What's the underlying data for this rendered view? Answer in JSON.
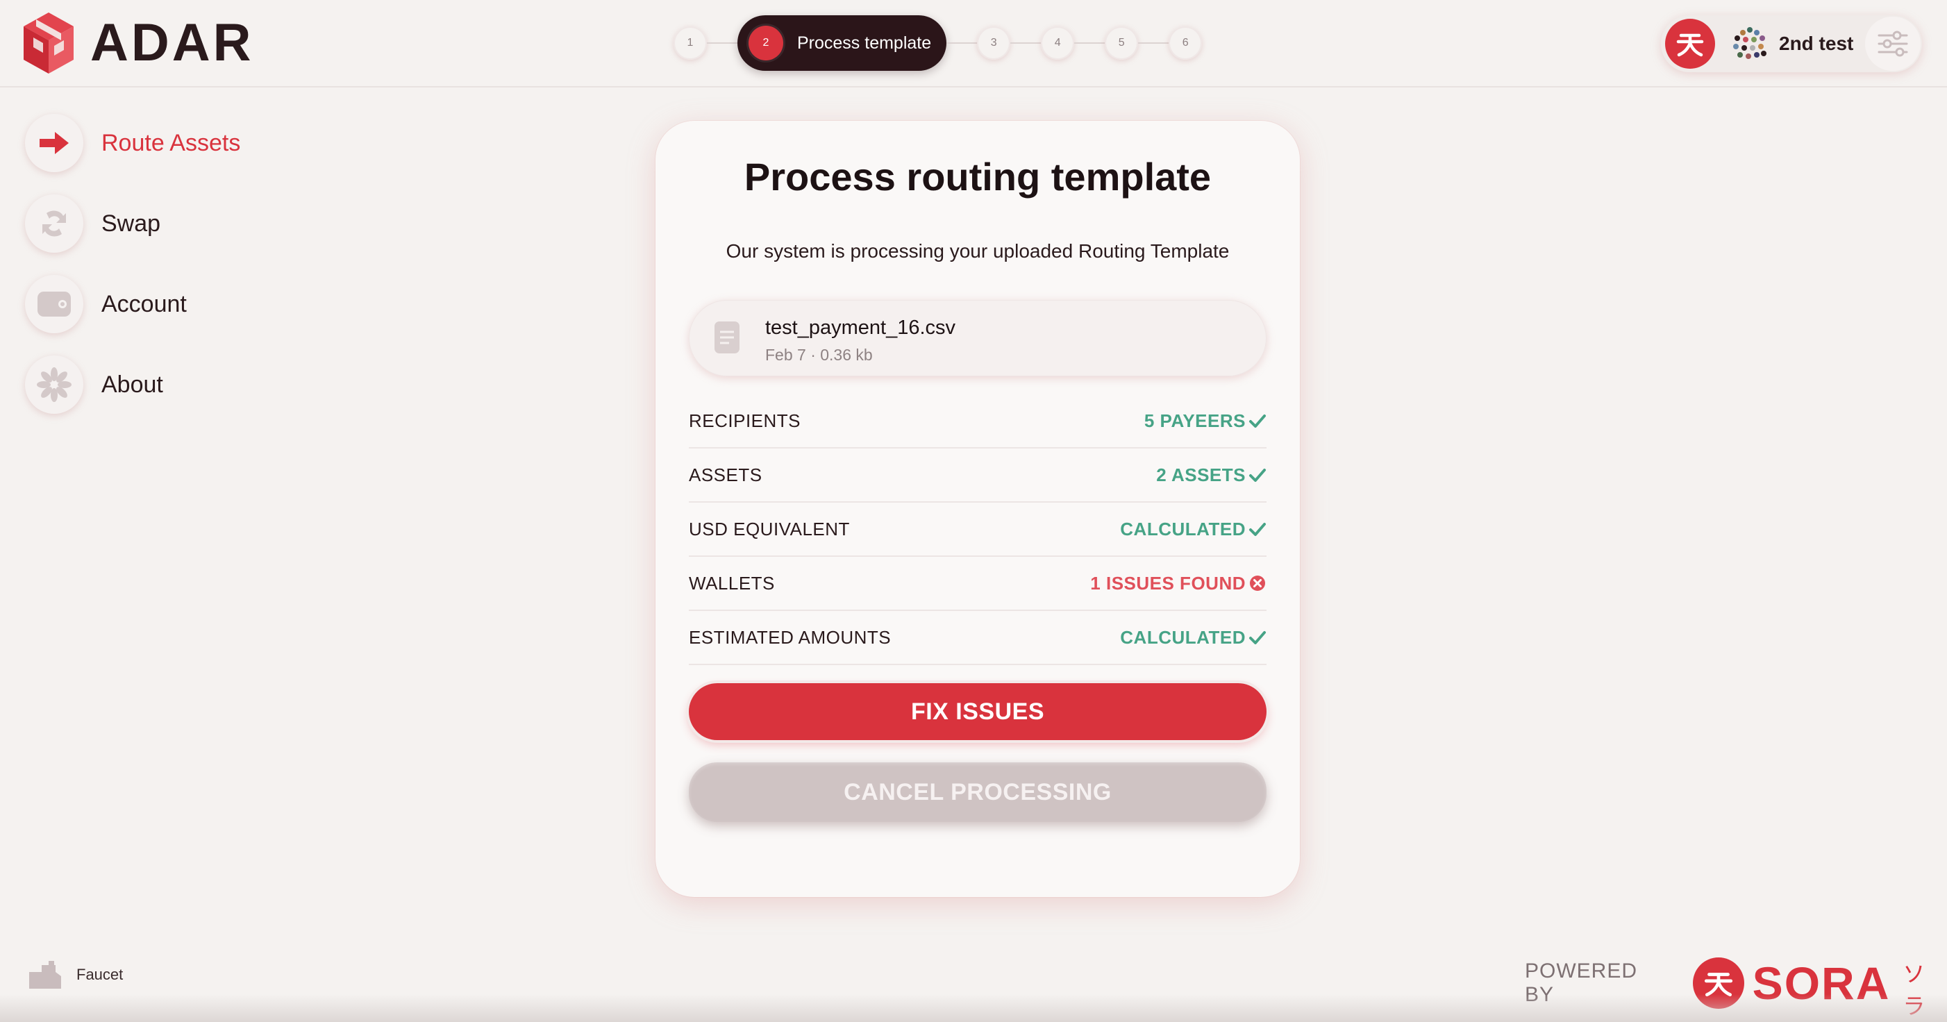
{
  "brand": {
    "name": "ADAR"
  },
  "stepper": {
    "steps": [
      "1",
      "2",
      "3",
      "4",
      "5",
      "6"
    ],
    "active_index": 2,
    "active_label": "Process template"
  },
  "account": {
    "name": "2nd test"
  },
  "sidebar": {
    "items": [
      {
        "label": "Route Assets",
        "icon": "arrow-right-icon",
        "active": true
      },
      {
        "label": "Swap",
        "icon": "swap-icon",
        "active": false
      },
      {
        "label": "Account",
        "icon": "wallet-icon",
        "active": false
      },
      {
        "label": "About",
        "icon": "flower-icon",
        "active": false
      }
    ]
  },
  "card": {
    "title": "Process routing template",
    "subtitle": "Our system is processing your uploaded Routing Template",
    "file": {
      "name": "test_payment_16.csv",
      "meta": "Feb 7 · 0.36 kb"
    },
    "rows": [
      {
        "label": "RECIPIENTS",
        "value": "5 PAYEERS",
        "status": "ok"
      },
      {
        "label": "ASSETS",
        "value": "2 ASSETS",
        "status": "ok"
      },
      {
        "label": "USD EQUIVALENT",
        "value": "CALCULATED",
        "status": "ok"
      },
      {
        "label": "WALLETS",
        "value": "1 ISSUES FOUND",
        "status": "error"
      },
      {
        "label": "ESTIMATED AMOUNTS",
        "value": "CALCULATED",
        "status": "ok"
      }
    ],
    "fix_label": "FIX ISSUES",
    "cancel_label": "CANCEL PROCESSING"
  },
  "footer": {
    "faucet_label": "Faucet",
    "powered_by": "POWERED BY",
    "sora_word": "SORA",
    "sora_kana": "ソラ"
  },
  "colors": {
    "accent": "#d9333d",
    "ok": "#46a386",
    "error": "#e0505a",
    "dark": "#2b1519",
    "background": "#f5f2f0"
  }
}
